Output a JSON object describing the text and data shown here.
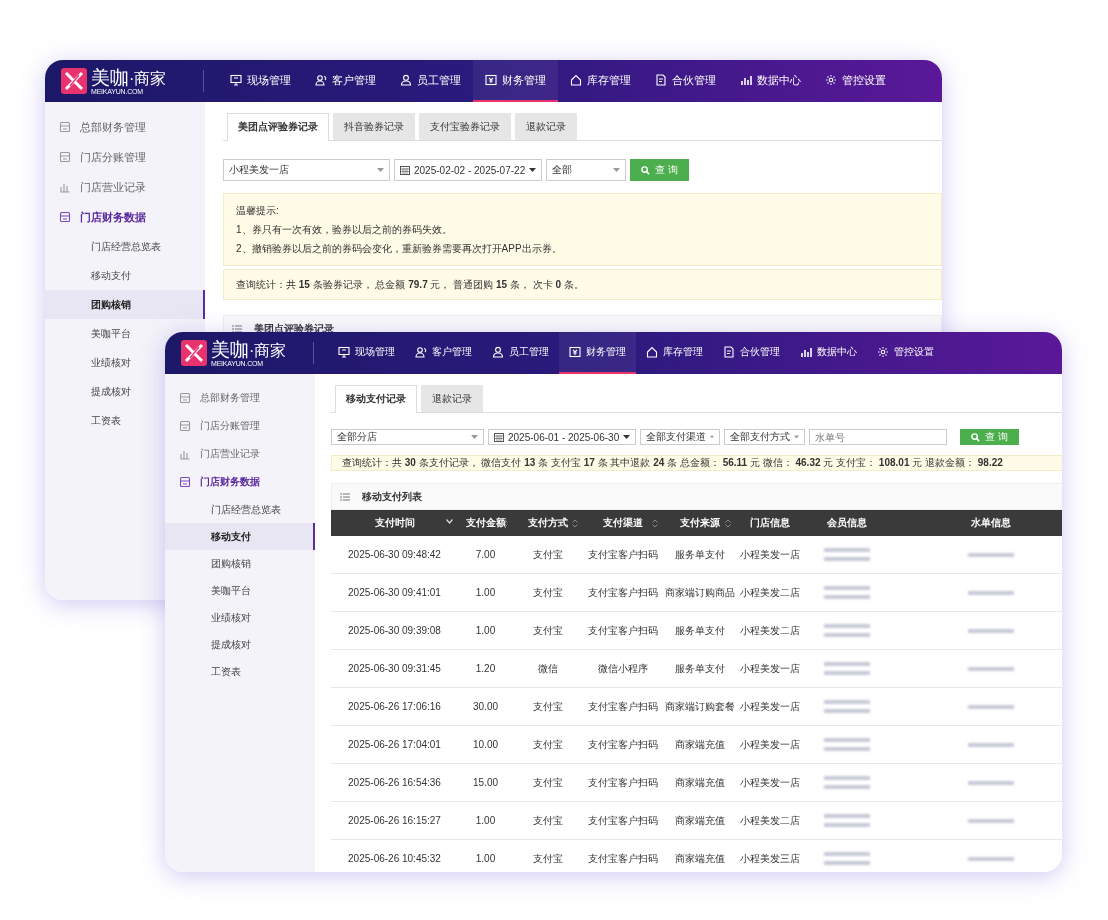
{
  "windows": [
    {
      "logo": {
        "name": "美咖",
        "suffix": "·商家",
        "site": "MEIKAYUN.COM"
      },
      "nav": [
        {
          "label": "现场管理",
          "selected": false
        },
        {
          "label": "客户管理",
          "selected": false
        },
        {
          "label": "员工管理",
          "selected": false
        },
        {
          "label": "财务管理",
          "selected": true
        },
        {
          "label": "库存管理",
          "selected": false
        },
        {
          "label": "合伙管理",
          "selected": false
        },
        {
          "label": "数据中心",
          "selected": false
        },
        {
          "label": "管控设置",
          "selected": false
        }
      ],
      "sidebar": [
        {
          "label": "总部财务管理",
          "expanded": false
        },
        {
          "label": "门店分账管理",
          "expanded": false
        },
        {
          "label": "门店营业记录",
          "expanded": false
        },
        {
          "label": "门店财务数据",
          "expanded": true,
          "children": [
            {
              "label": "门店经营总览表",
              "selected": false
            },
            {
              "label": "移动支付",
              "selected": false
            },
            {
              "label": "团购核销",
              "selected": true
            },
            {
              "label": "美咖平台",
              "selected": false
            },
            {
              "label": "业绩核对",
              "selected": false
            },
            {
              "label": "提成核对",
              "selected": false
            },
            {
              "label": "工资表",
              "selected": false
            }
          ]
        }
      ],
      "tabs": [
        {
          "label": "美团点评验券记录",
          "selected": true
        },
        {
          "label": "抖音验券记录",
          "selected": false
        },
        {
          "label": "支付宝验券记录",
          "selected": false
        },
        {
          "label": "退款记录",
          "selected": false
        }
      ],
      "filters": [
        {
          "kind": "select",
          "value": "小程美发一店"
        },
        {
          "kind": "date",
          "value": "2025-02-02 - 2025-07-22"
        },
        {
          "kind": "select",
          "value": "全部"
        },
        {
          "kind": "button",
          "label": "查 询"
        }
      ],
      "notice": {
        "title": "温馨提示:",
        "lines": [
          "1、券只有一次有效，验券以后之前的券码失效。",
          "2、撤销验券以后之前的券码会变化，重新验券需要再次打开APP出示券。"
        ]
      },
      "stats": "查询统计：共 **15** 条验券记录， 总金额 **79.7** 元， 普通团购 **15** 条， 次卡 **0** 条。",
      "table": {
        "title": "美团点评验券记录"
      }
    },
    {
      "logo": {
        "name": "美咖",
        "suffix": "·商家",
        "site": "MEIKAYUN.COM"
      },
      "nav": [
        {
          "label": "现场管理",
          "selected": false
        },
        {
          "label": "客户管理",
          "selected": false
        },
        {
          "label": "员工管理",
          "selected": false
        },
        {
          "label": "财务管理",
          "selected": true
        },
        {
          "label": "库存管理",
          "selected": false
        },
        {
          "label": "合伙管理",
          "selected": false
        },
        {
          "label": "数据中心",
          "selected": false
        },
        {
          "label": "管控设置",
          "selected": false
        }
      ],
      "sidebar": [
        {
          "label": "总部财务管理",
          "expanded": false
        },
        {
          "label": "门店分账管理",
          "expanded": false
        },
        {
          "label": "门店营业记录",
          "expanded": false
        },
        {
          "label": "门店财务数据",
          "expanded": true,
          "children": [
            {
              "label": "门店经营总览表",
              "selected": false
            },
            {
              "label": "移动支付",
              "selected": true
            },
            {
              "label": "团购核销",
              "selected": false
            },
            {
              "label": "美咖平台",
              "selected": false
            },
            {
              "label": "业绩核对",
              "selected": false
            },
            {
              "label": "提成核对",
              "selected": false
            },
            {
              "label": "工资表",
              "selected": false
            }
          ]
        }
      ],
      "tabs": [
        {
          "label": "移动支付记录",
          "selected": true
        },
        {
          "label": "退款记录",
          "selected": false
        }
      ],
      "filters": [
        {
          "kind": "select",
          "value": "全部分店"
        },
        {
          "kind": "date",
          "value": "2025-06-01 - 2025-06-30"
        },
        {
          "kind": "select",
          "value": "全部支付渠道"
        },
        {
          "kind": "select",
          "value": "全部支付方式"
        },
        {
          "kind": "input",
          "placeholder": "水单号"
        },
        {
          "kind": "button",
          "label": "查 询"
        }
      ],
      "stats": "查询统计：共 **30** 条支付记录， 微信支付 **13** 条  支付宝 **17** 条  其中退款 **24** 条  总金额： **56.11** 元  微信： **46.32** 元  支付宝： **108.01** 元  退款金额： **98.22**",
      "table": {
        "title": "移动支付列表",
        "columns": [
          {
            "label": "支付时间",
            "sorted": true
          },
          {
            "label": "支付金额",
            "sorted": false,
            "sortable": true
          },
          {
            "label": "支付方式",
            "sorted": false,
            "sortable": true
          },
          {
            "label": "支付渠道",
            "sorted": false,
            "sortable": true
          },
          {
            "label": "支付来源",
            "sorted": false,
            "sortable": true
          },
          {
            "label": "门店信息",
            "sorted": false,
            "sortable": false
          },
          {
            "label": "会员信息",
            "sorted": false,
            "sortable": false
          },
          {
            "label": "水单信息",
            "sorted": false,
            "sortable": false
          }
        ],
        "rows": [
          [
            "2025-06-30 09:48:42",
            "7.00",
            "支付宝",
            "支付宝客户扫码",
            "服务单支付",
            "小程美发一店"
          ],
          [
            "2025-06-30 09:41:01",
            "1.00",
            "支付宝",
            "支付宝客户扫码",
            "商家端订购商品",
            "小程美发二店"
          ],
          [
            "2025-06-30 09:39:08",
            "1.00",
            "支付宝",
            "支付宝客户扫码",
            "服务单支付",
            "小程美发二店"
          ],
          [
            "2025-06-30 09:31:45",
            "1.20",
            "微信",
            "微信小程序",
            "服务单支付",
            "小程美发一店"
          ],
          [
            "2025-06-26 17:06:16",
            "30.00",
            "支付宝",
            "支付宝客户扫码",
            "商家端订购套餐",
            "小程美发一店"
          ],
          [
            "2025-06-26 17:04:01",
            "10.00",
            "支付宝",
            "支付宝客户扫码",
            "商家端充值",
            "小程美发一店"
          ],
          [
            "2025-06-26 16:54:36",
            "15.00",
            "支付宝",
            "支付宝客户扫码",
            "商家端充值",
            "小程美发一店"
          ],
          [
            "2025-06-26 16:15:27",
            "1.00",
            "支付宝",
            "支付宝客户扫码",
            "商家端充值",
            "小程美发二店"
          ],
          [
            "2025-06-26 10:45:32",
            "1.00",
            "支付宝",
            "支付宝客户扫码",
            "商家端充值",
            "小程美发三店"
          ]
        ]
      }
    }
  ]
}
